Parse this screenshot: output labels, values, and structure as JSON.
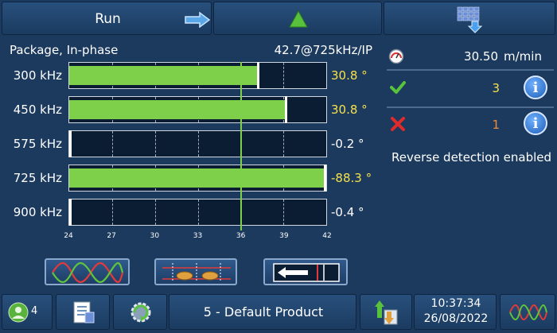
{
  "header": {
    "run_label": "Run"
  },
  "panel": {
    "title": "Package, In-phase",
    "measure": "42.7@725kHz/IP"
  },
  "bars": [
    {
      "freq": "300 kHz",
      "value_text": "30.8 °",
      "fill": 0.73,
      "needle": 0.73,
      "color": "#f5e24a"
    },
    {
      "freq": "450 kHz",
      "value_text": "30.8 °",
      "fill": 0.84,
      "needle": 0.84,
      "color": "#f5e24a"
    },
    {
      "freq": "575 kHz",
      "value_text": "-0.2 °",
      "fill": 0,
      "needle": 0,
      "color": "#ffffff"
    },
    {
      "freq": "725 kHz",
      "value_text": "-88.3 °",
      "fill": 1.0,
      "needle": 1.0,
      "color": "#f5e24a"
    },
    {
      "freq": "900 kHz",
      "value_text": "-0.4 °",
      "fill": 0,
      "needle": 0,
      "color": "#ffffff"
    }
  ],
  "axis": {
    "ticks": [
      "24",
      "27",
      "30",
      "33",
      "36",
      "39",
      "42"
    ],
    "threshold": 36
  },
  "side": {
    "speed": "30.50",
    "speed_unit": "m/min",
    "pass_count": "3",
    "reject_count": "1",
    "reverse_text": "Reverse detection enabled"
  },
  "footer": {
    "user_count": "4",
    "product": "5 - Default Product",
    "time": "10:37:34",
    "date": "26/08/2022"
  },
  "colors": {
    "bar_fill": "#7ed04a",
    "accent_yellow": "#f5e24a",
    "reject_orange": "#f08a3a",
    "pass_yellow": "#f5e24a"
  }
}
